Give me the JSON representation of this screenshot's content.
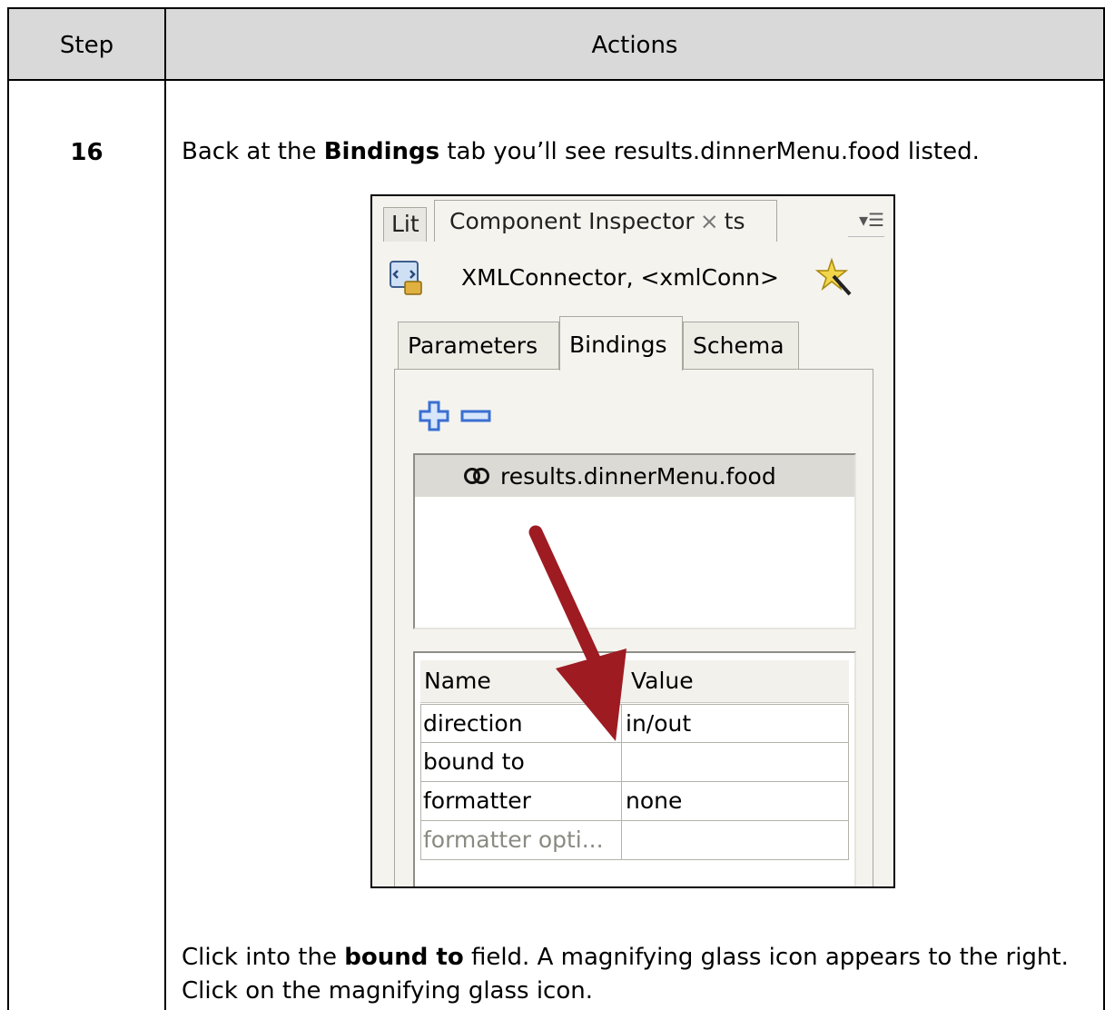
{
  "table": {
    "header": {
      "step": "Step",
      "actions": "Actions"
    },
    "row": {
      "step_number": "16",
      "intro": {
        "pre": "Back at the ",
        "bold": "Bindings",
        "post": " tab you’ll see results.dinnerMenu.food listed."
      },
      "outro": {
        "pre": "Click into the ",
        "bold": "bound to",
        "post": " field. A magnifying glass icon appears to the right. Click on the magnifying glass icon."
      }
    }
  },
  "panel": {
    "tabs": {
      "library_partial": "Lit",
      "inspector": "Component Inspector",
      "close_glyph": "×",
      "partial_right": "ts"
    },
    "component_label": "XMLConnector, <xmlConn>",
    "subtabs": [
      "Parameters",
      "Bindings",
      "Schema"
    ],
    "active_subtab": "Bindings",
    "bindings": [
      "results.dinnerMenu.food"
    ],
    "properties": {
      "headers": {
        "name": "Name",
        "value": "Value"
      },
      "rows": [
        {
          "name": "direction",
          "value": "in/out"
        },
        {
          "name": "bound to",
          "value": ""
        },
        {
          "name": "formatter",
          "value": "none"
        },
        {
          "name": "formatter opti...",
          "value": ""
        }
      ]
    },
    "icons": [
      "xml-connector-icon",
      "wizard-icon",
      "add-binding-icon",
      "remove-binding-icon",
      "binding-link-icon",
      "panel-menu-icon"
    ],
    "colors": {
      "annotation_arrow": "#9e1b22",
      "header_bg": "#d9d9d9",
      "add_icon": "#3a6fd1"
    }
  }
}
